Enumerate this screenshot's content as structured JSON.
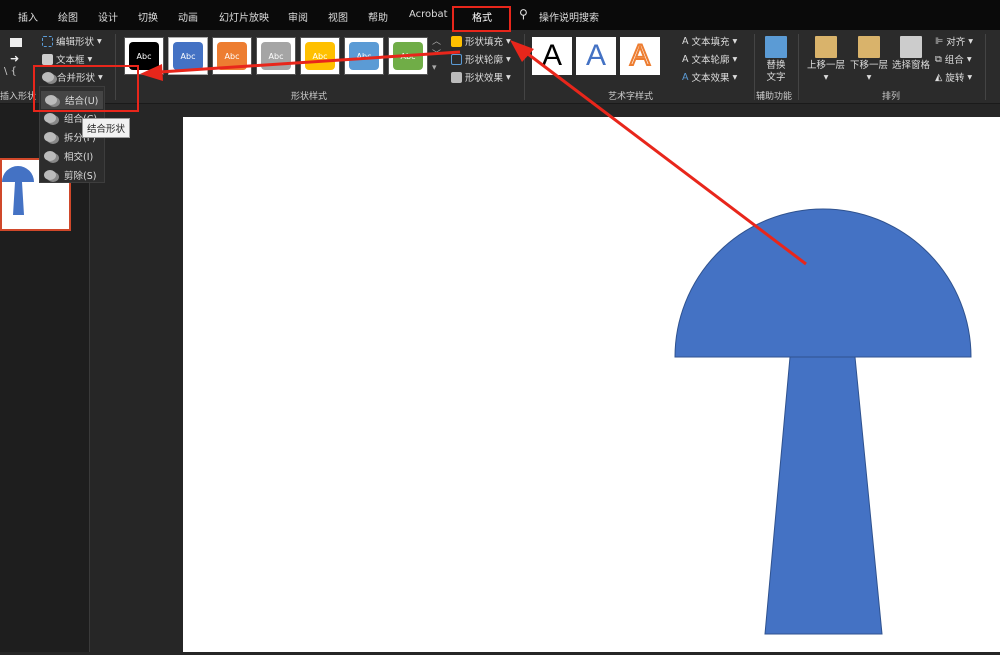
{
  "tabs": [
    "插入",
    "绘图",
    "设计",
    "切换",
    "动画",
    "幻灯片放映",
    "审阅",
    "视图",
    "帮助",
    "Acrobat",
    "格式"
  ],
  "active_tab": "格式",
  "search": {
    "label": "操作说明搜索",
    "icon": "lightbulb-icon"
  },
  "insert_shapes": {
    "edit_shape": "编辑形状",
    "text_box": "文本框",
    "merge_shapes": "合并形状",
    "group_label": "插入形状"
  },
  "shape_styles": {
    "swatches": [
      {
        "label": "Abc",
        "color": "#000000"
      },
      {
        "label": "Abc",
        "color": "#4472c4"
      },
      {
        "label": "Abc",
        "color": "#ed7d31"
      },
      {
        "label": "Abc",
        "color": "#a5a5a5"
      },
      {
        "label": "Abc",
        "color": "#ffc000"
      },
      {
        "label": "Abc",
        "color": "#5b9bd5"
      },
      {
        "label": "Abc",
        "color": "#70ad47"
      }
    ],
    "fill": "形状填充",
    "outline": "形状轮廓",
    "effects": "形状效果",
    "group_label": "形状样式"
  },
  "wordart": {
    "samples": [
      "A",
      "A",
      "A"
    ],
    "text_fill": "文本填充",
    "text_outline": "文本轮廓",
    "text_effects": "文本效果",
    "group_label": "艺术字样式"
  },
  "accessibility": {
    "alt_text_1": "替换",
    "alt_text_2": "文字",
    "group_label": "辅助功能"
  },
  "arrange": {
    "bring_forward": "上移一层",
    "send_backward": "下移一层",
    "selection_pane": "选择窗格",
    "align": "对齐",
    "group": "组合",
    "rotate": "旋转",
    "group_label": "排列"
  },
  "merge_menu": {
    "items": [
      "结合(U)",
      "组合(C)",
      "拆分(F)",
      "相交(I)",
      "剪除(S)"
    ],
    "tooltip": "结合形状"
  },
  "colors": {
    "accent": "#e8261b",
    "shape": "#4472c4"
  }
}
